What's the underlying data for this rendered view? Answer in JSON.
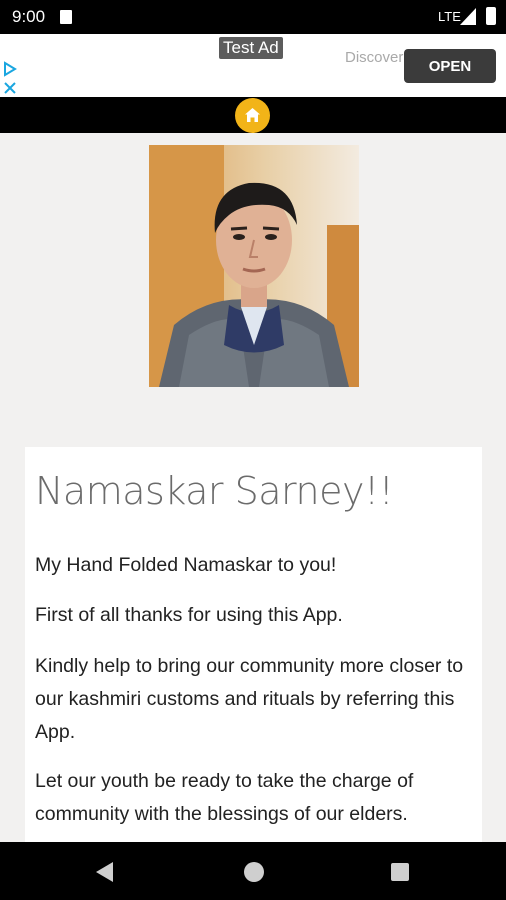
{
  "status_bar": {
    "time": "9:00",
    "network": "LTE"
  },
  "ad": {
    "label": "Test Ad",
    "teaser": "Discover needs o",
    "open_label": "OPEN"
  },
  "card": {
    "title": "Namaskar Sarney!!",
    "paragraphs": [
      "My Hand Folded Namaskar to you!",
      "First of all thanks for using this App.",
      "Kindly help to bring our community more closer to our kashmiri customs and rituals by referring this App.",
      "Let our youth be ready to take the charge of community with the blessings of our elders."
    ]
  },
  "icons": {
    "home": "home-icon",
    "ad_choices": "adchoices-icon",
    "back": "back-icon",
    "nav_home": "circle-home-icon",
    "recents": "recents-icon"
  },
  "colors": {
    "accent": "#f2b418",
    "background": "#f2f1f0"
  }
}
